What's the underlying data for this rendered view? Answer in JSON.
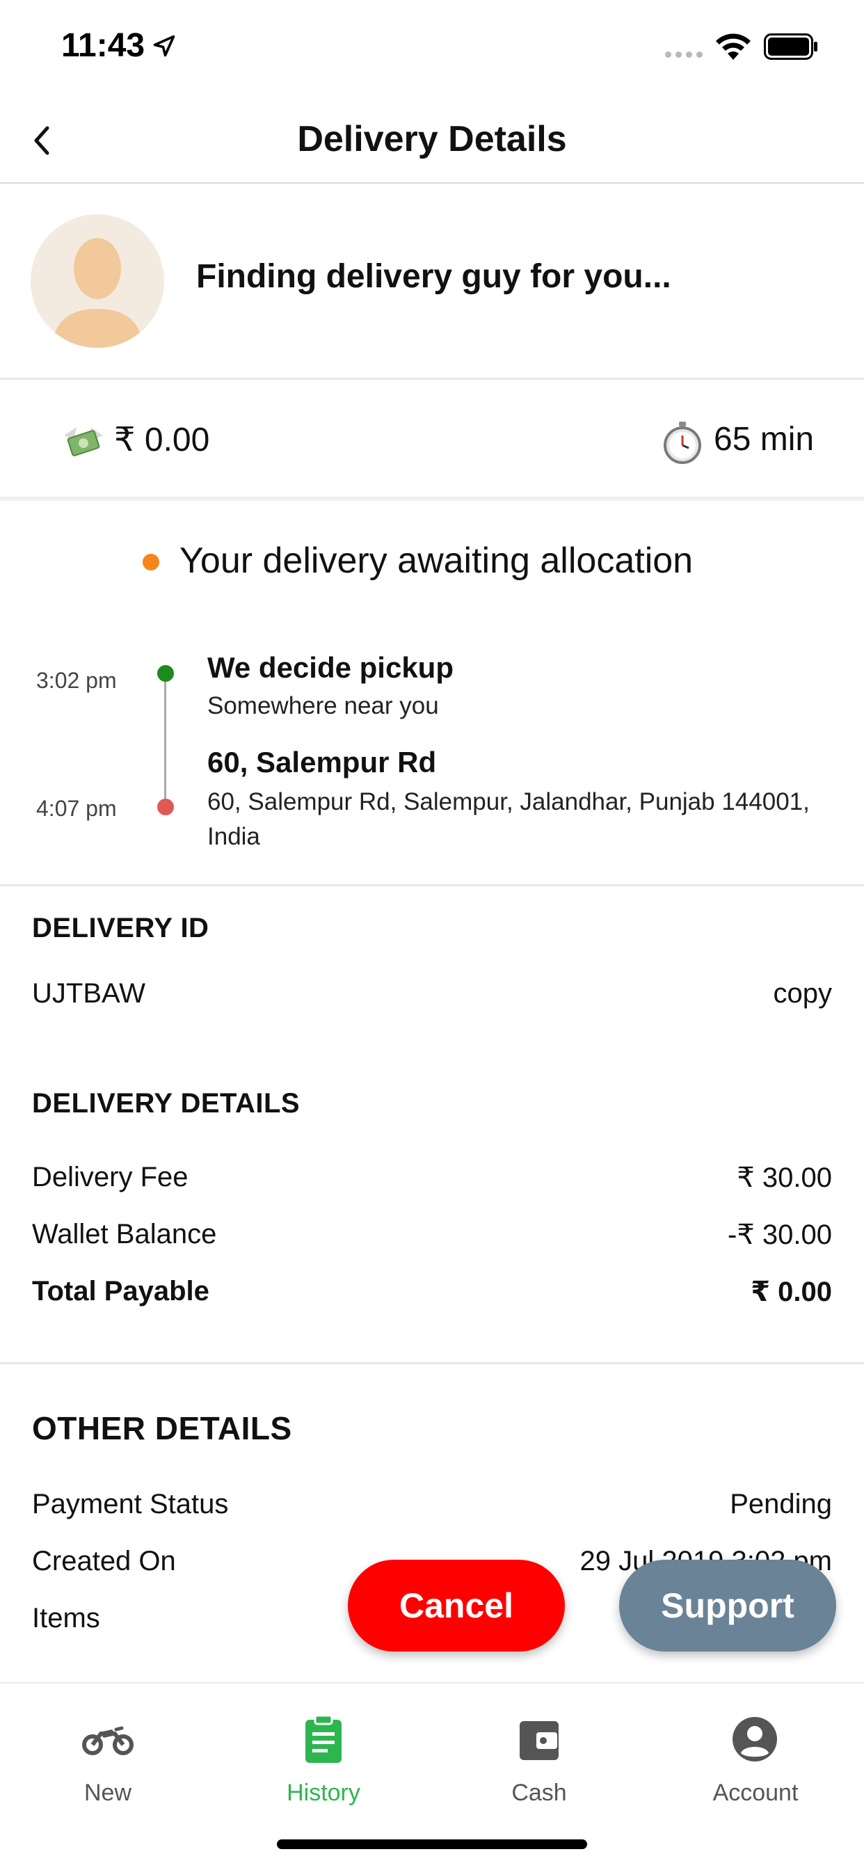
{
  "status_bar": {
    "time": "11:43"
  },
  "nav": {
    "title": "Delivery Details"
  },
  "driver": {
    "status_text": "Finding delivery guy for you..."
  },
  "fare": {
    "amount": "₹ 0.00",
    "eta": "65 min"
  },
  "allocation": {
    "status_text": "Your delivery awaiting allocation",
    "status_color": "#f7851e",
    "pickup": {
      "time": "3:02 pm",
      "title": "We decide pickup",
      "subtitle": "Somewhere near you",
      "dot_color": "#1e8a1e"
    },
    "drop": {
      "time": "4:07 pm",
      "title": "60, Salempur Rd",
      "subtitle": "60, Salempur Rd, Salempur, Jalandhar, Punjab 144001, India",
      "dot_color": "#e05a55"
    }
  },
  "delivery_id": {
    "heading": "DELIVERY ID",
    "value": "UJTBAW",
    "copy_label": "copy"
  },
  "delivery_details": {
    "heading": "DELIVERY DETAILS",
    "rows": [
      {
        "label": "Delivery Fee",
        "value": "₹ 30.00"
      },
      {
        "label": "Wallet Balance",
        "value": "-₹ 30.00"
      },
      {
        "label": "Total Payable",
        "value": "₹ 0.00"
      }
    ]
  },
  "other_details": {
    "heading": "OTHER DETAILS",
    "rows": [
      {
        "label": "Payment Status",
        "value": "Pending"
      },
      {
        "label": "Created On",
        "value": "29 Jul 2019 3:02 pm"
      },
      {
        "label": "Items",
        "value": ""
      }
    ]
  },
  "actions": {
    "cancel_label": "Cancel",
    "cancel_color": "#ff0000",
    "support_label": "Support",
    "support_color": "#6a8396"
  },
  "tabs": [
    {
      "label": "New",
      "icon": "motorbike-icon",
      "active": false
    },
    {
      "label": "History",
      "icon": "clipboard-icon",
      "active": true
    },
    {
      "label": "Cash",
      "icon": "wallet-icon",
      "active": false
    },
    {
      "label": "Account",
      "icon": "account-circle-icon",
      "active": false
    }
  ],
  "accent_color": "#2eb64e"
}
